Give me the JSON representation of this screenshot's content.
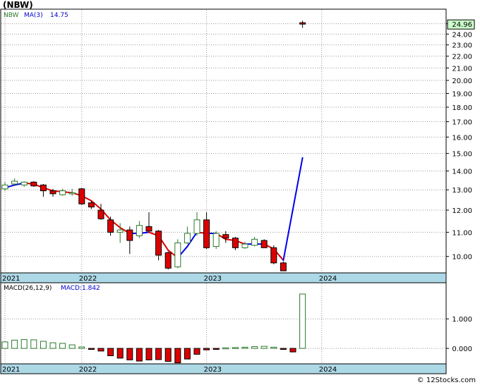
{
  "title": "(NBW)",
  "watermark": "© 12Stocks.com",
  "colors": {
    "up_body": "#ffffff",
    "up_edge": "#2a7a2a",
    "down_body": "#dd0000",
    "ma_up": "#0000ee",
    "ma_down": "#dd0000",
    "macd_up_edge": "#2a7a2a",
    "macd_down_body": "#dd0000",
    "axis_band": "#add8e6",
    "price_label_bg": "#ccffcc"
  },
  "chart_data": [
    {
      "type": "candlestick",
      "legend": {
        "symbol": "NBW",
        "ma_label": "MA(3)",
        "ma_value": "14.75"
      },
      "last_price_label": "24.96",
      "y_tick_labels": [
        "10.00",
        "11.00",
        "12.00",
        "13.00",
        "14.00",
        "15.00",
        "16.00",
        "17.00",
        "18.00",
        "19.00",
        "20.00",
        "21.00",
        "22.00",
        "23.00",
        "24.00",
        "25.00"
      ],
      "y_scale": "log",
      "ylim": [
        9.4,
        26.4
      ],
      "x_tick_labels": [
        "2021",
        "2022",
        "2023",
        "2024"
      ],
      "x_tick_index": [
        0,
        8,
        21,
        33
      ],
      "grid": true,
      "candles": [
        {
          "o": 13.05,
          "h": 13.4,
          "l": 12.95,
          "c": 13.25
        },
        {
          "o": 13.3,
          "h": 13.6,
          "l": 13.2,
          "c": 13.45
        },
        {
          "o": 13.25,
          "h": 13.45,
          "l": 13.15,
          "c": 13.4
        },
        {
          "o": 13.4,
          "h": 13.45,
          "l": 13.15,
          "c": 13.2
        },
        {
          "o": 13.25,
          "h": 13.3,
          "l": 12.65,
          "c": 12.95
        },
        {
          "o": 12.95,
          "h": 13.05,
          "l": 12.65,
          "c": 12.8
        },
        {
          "o": 12.75,
          "h": 13.05,
          "l": 12.7,
          "c": 12.95
        },
        {
          "o": 12.8,
          "h": 13.05,
          "l": 12.7,
          "c": 12.85
        },
        {
          "o": 13.05,
          "h": 13.1,
          "l": 12.25,
          "c": 12.3
        },
        {
          "o": 12.35,
          "h": 12.45,
          "l": 12.05,
          "c": 12.15
        },
        {
          "o": 12.0,
          "h": 12.3,
          "l": 11.55,
          "c": 11.6
        },
        {
          "o": 11.55,
          "h": 11.7,
          "l": 10.85,
          "c": 11.0
        },
        {
          "o": 11.0,
          "h": 11.4,
          "l": 10.55,
          "c": 11.1
        },
        {
          "o": 11.1,
          "h": 11.25,
          "l": 10.1,
          "c": 10.65
        },
        {
          "o": 10.85,
          "h": 11.5,
          "l": 10.75,
          "c": 11.3
        },
        {
          "o": 11.25,
          "h": 11.9,
          "l": 11.05,
          "c": 11.05
        },
        {
          "o": 11.05,
          "h": 11.1,
          "l": 9.85,
          "c": 10.05
        },
        {
          "o": 10.15,
          "h": 10.2,
          "l": 9.5,
          "c": 9.55
        },
        {
          "o": 9.6,
          "h": 10.7,
          "l": 9.55,
          "c": 10.55
        },
        {
          "o": 10.55,
          "h": 11.25,
          "l": 10.5,
          "c": 10.95
        },
        {
          "o": 10.95,
          "h": 11.9,
          "l": 10.85,
          "c": 11.55
        },
        {
          "o": 11.55,
          "h": 11.9,
          "l": 10.3,
          "c": 10.35
        },
        {
          "o": 10.4,
          "h": 11.05,
          "l": 10.3,
          "c": 10.95
        },
        {
          "o": 10.9,
          "h": 11.05,
          "l": 10.55,
          "c": 10.75
        },
        {
          "o": 10.75,
          "h": 10.8,
          "l": 10.25,
          "c": 10.35
        },
        {
          "o": 10.35,
          "h": 10.6,
          "l": 10.3,
          "c": 10.5
        },
        {
          "o": 10.45,
          "h": 10.8,
          "l": 10.4,
          "c": 10.7
        },
        {
          "o": 10.65,
          "h": 10.7,
          "l": 10.35,
          "c": 10.35
        },
        {
          "o": 10.35,
          "h": 10.45,
          "l": 9.7,
          "c": 9.75
        },
        {
          "o": 9.75,
          "h": 9.8,
          "l": 9.45,
          "c": 9.45
        },
        {
          "o": 25.1,
          "h": 25.3,
          "l": 24.6,
          "c": 24.96
        }
      ],
      "candle_x_index": [
        0,
        1,
        2,
        3,
        4,
        5,
        6,
        7,
        8,
        9,
        10,
        11,
        12,
        13,
        14,
        15,
        16,
        17,
        18,
        19,
        20,
        21,
        22,
        23,
        24,
        25,
        26,
        27,
        28,
        29,
        31
      ],
      "ma3": [
        13.1,
        13.25,
        13.35,
        13.3,
        13.1,
        12.95,
        12.9,
        12.85,
        12.7,
        12.45,
        12.05,
        11.55,
        11.2,
        10.95,
        10.95,
        11.0,
        10.85,
        10.25,
        9.95,
        10.4,
        11.0,
        10.95,
        10.95,
        10.7,
        10.65,
        10.5,
        10.5,
        10.5,
        10.3,
        9.85,
        14.75
      ]
    },
    {
      "type": "bar",
      "legend": {
        "label": "MACD(26,12,9)",
        "macd_label": "MACD:",
        "macd_value": "1.842"
      },
      "y_tick_labels": [
        "0.000",
        "1.000"
      ],
      "ylim": [
        -0.5,
        2.2
      ],
      "x_tick_labels": [
        "2021",
        "2022",
        "2023",
        "2024"
      ],
      "values": [
        0.22,
        0.28,
        0.3,
        0.29,
        0.24,
        0.19,
        0.17,
        0.12,
        0.05,
        -0.02,
        -0.09,
        -0.25,
        -0.33,
        -0.39,
        -0.43,
        -0.39,
        -0.38,
        -0.44,
        -0.49,
        -0.36,
        -0.2,
        -0.05,
        -0.02,
        0.02,
        0.03,
        0.04,
        0.06,
        0.07,
        0.04,
        -0.02,
        -0.12,
        1.842
      ]
    }
  ]
}
